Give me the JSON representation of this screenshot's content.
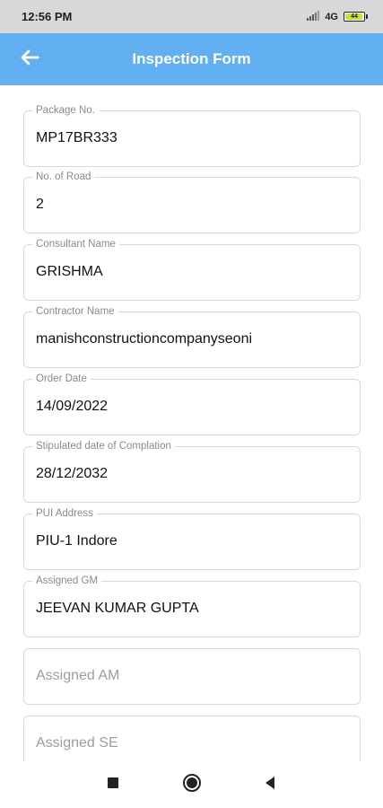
{
  "status_bar": {
    "time": "12:56 PM",
    "network": "4G",
    "battery_text": "44"
  },
  "app_bar": {
    "title": "Inspection Form",
    "back_icon": "arrow-left-icon"
  },
  "fields": [
    {
      "label": "Package No.",
      "value": "MP17BR333"
    },
    {
      "label": "No. of Road",
      "value": "2"
    },
    {
      "label": "Consultant Name",
      "value": "GRISHMA"
    },
    {
      "label": "Contractor Name",
      "value": "manishconstructioncompanyseoni"
    },
    {
      "label": "Order Date",
      "value": "14/09/2022"
    },
    {
      "label": "Stipulated date of Complation",
      "value": "28/12/2032"
    },
    {
      "label": "PUI Address",
      "value": "PIU-1 Indore"
    },
    {
      "label": "Assigned GM",
      "value": "JEEVAN KUMAR GUPTA"
    },
    {
      "placeholder": "Assigned AM"
    },
    {
      "placeholder": "Assigned SE"
    }
  ],
  "nav_bar": {
    "icons": [
      "recent-apps-icon",
      "home-icon",
      "back-triangle-icon"
    ]
  },
  "colors": {
    "app_bar": "#62b0f2",
    "status_bar": "#d8d8d8",
    "field_border": "#d9d9d9"
  }
}
